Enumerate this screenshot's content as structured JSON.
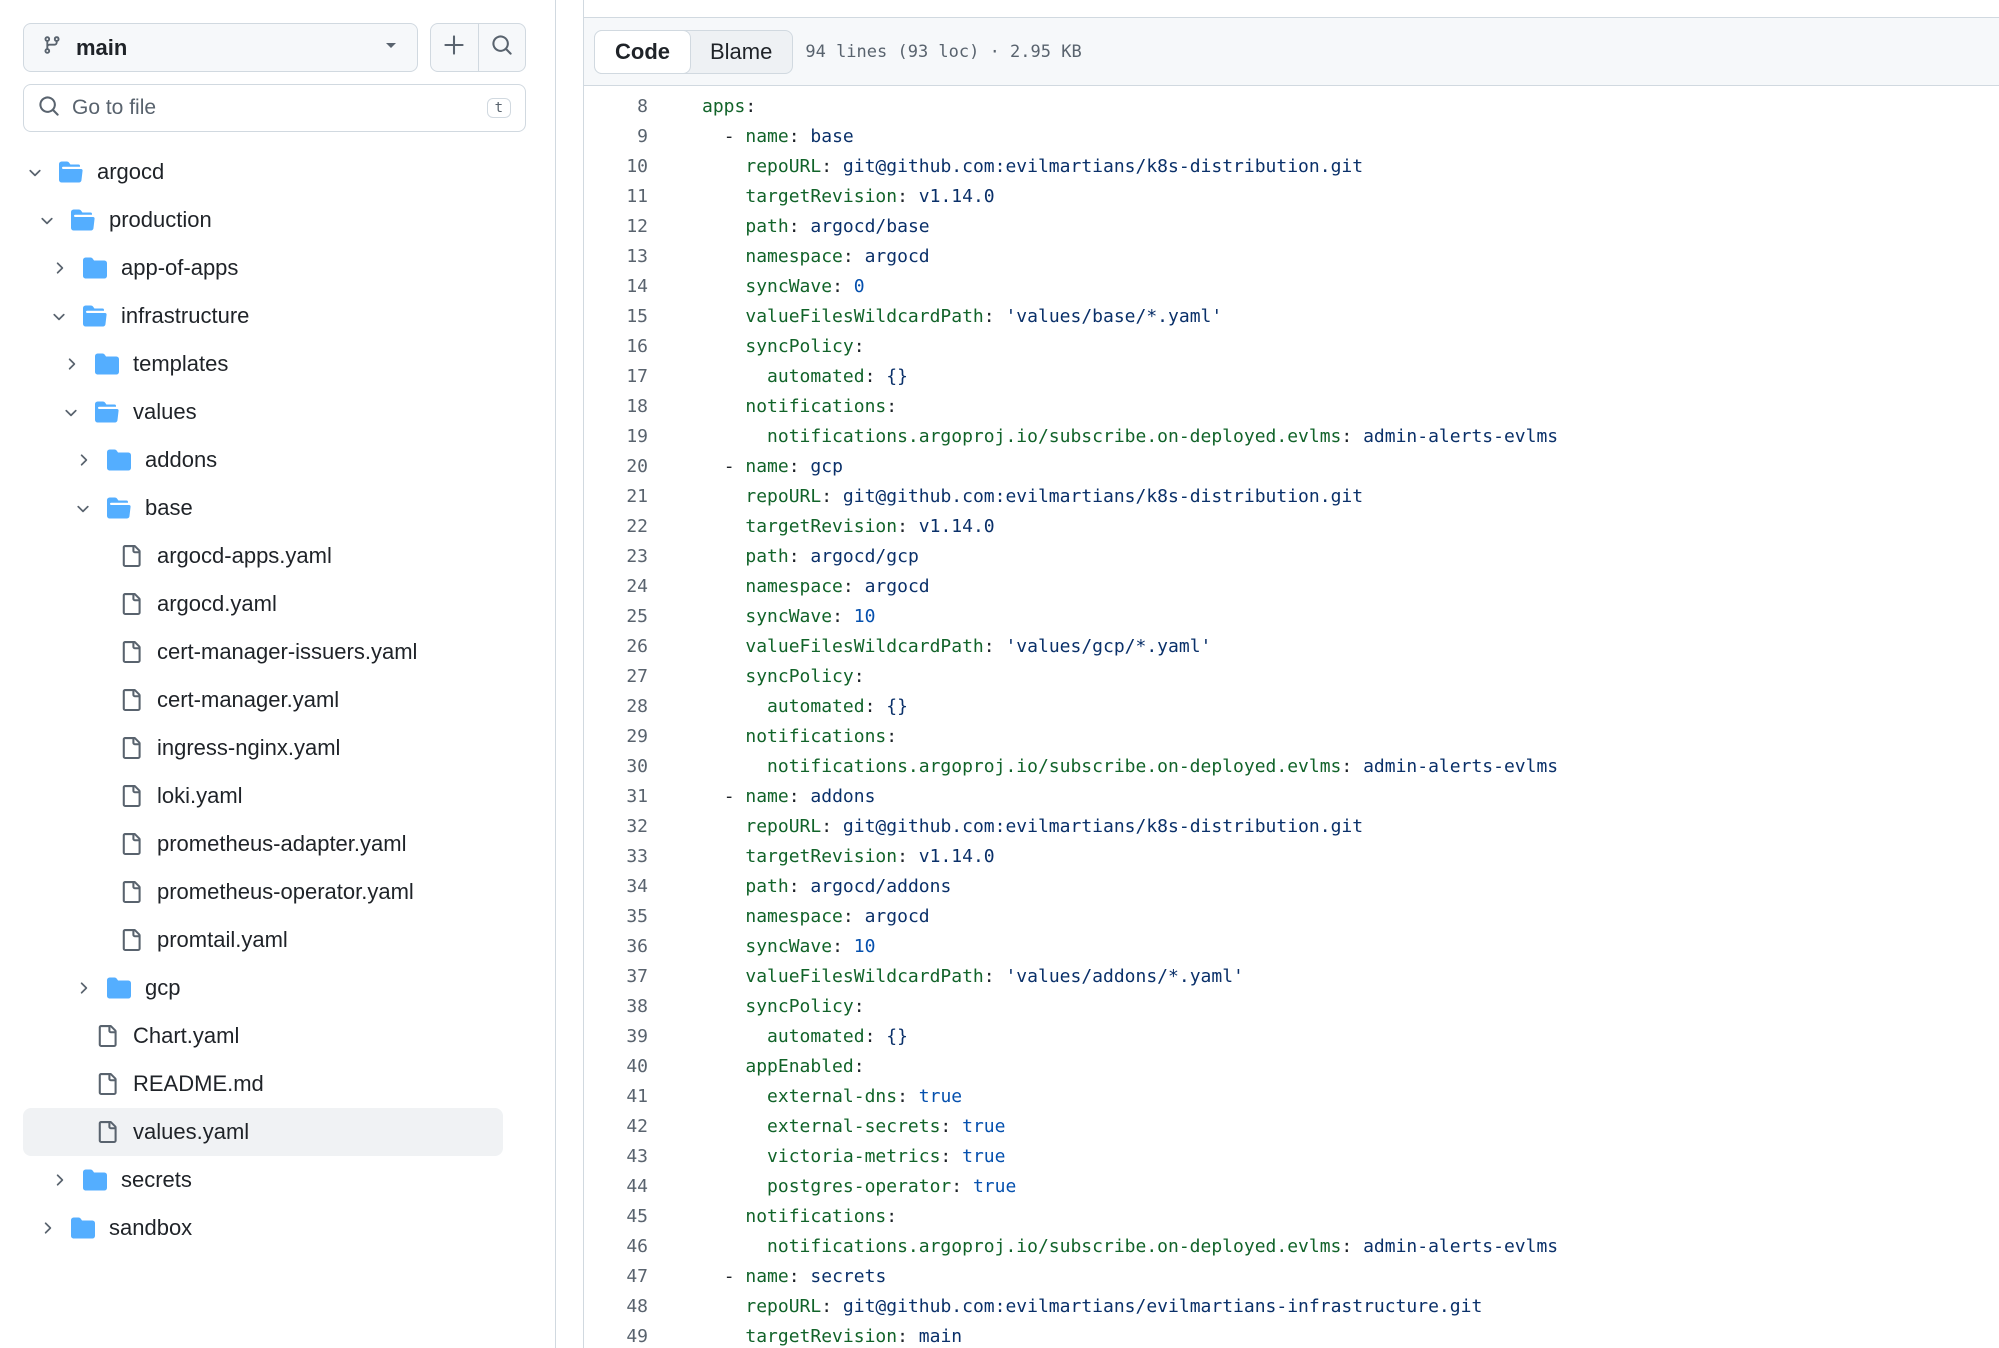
{
  "sidebar": {
    "branch": "main",
    "goto_placeholder": "Go to file",
    "goto_shortcut": "t",
    "tree": [
      {
        "name": "argocd",
        "type": "folder",
        "depth": 0,
        "open": true
      },
      {
        "name": "production",
        "type": "folder",
        "depth": 1,
        "open": true
      },
      {
        "name": "app-of-apps",
        "type": "folder",
        "depth": 2,
        "open": false
      },
      {
        "name": "infrastructure",
        "type": "folder",
        "depth": 2,
        "open": true
      },
      {
        "name": "templates",
        "type": "folder",
        "depth": 3,
        "open": false
      },
      {
        "name": "values",
        "type": "folder",
        "depth": 3,
        "open": true
      },
      {
        "name": "addons",
        "type": "folder",
        "depth": 4,
        "open": false
      },
      {
        "name": "base",
        "type": "folder",
        "depth": 4,
        "open": true
      },
      {
        "name": "argocd-apps.yaml",
        "type": "file",
        "depth": 5
      },
      {
        "name": "argocd.yaml",
        "type": "file",
        "depth": 5
      },
      {
        "name": "cert-manager-issuers.yaml",
        "type": "file",
        "depth": 5
      },
      {
        "name": "cert-manager.yaml",
        "type": "file",
        "depth": 5
      },
      {
        "name": "ingress-nginx.yaml",
        "type": "file",
        "depth": 5
      },
      {
        "name": "loki.yaml",
        "type": "file",
        "depth": 5
      },
      {
        "name": "prometheus-adapter.yaml",
        "type": "file",
        "depth": 5
      },
      {
        "name": "prometheus-operator.yaml",
        "type": "file",
        "depth": 5
      },
      {
        "name": "promtail.yaml",
        "type": "file",
        "depth": 5
      },
      {
        "name": "gcp",
        "type": "folder",
        "depth": 4,
        "open": false
      },
      {
        "name": "Chart.yaml",
        "type": "file",
        "depth": 3
      },
      {
        "name": "README.md",
        "type": "file",
        "depth": 3
      },
      {
        "name": "values.yaml",
        "type": "file",
        "depth": 3,
        "selected": true
      },
      {
        "name": "secrets",
        "type": "folder",
        "depth": 2,
        "open": false
      },
      {
        "name": "sandbox",
        "type": "folder",
        "depth": 1,
        "open": false
      }
    ]
  },
  "viewer": {
    "tabs": [
      "Code",
      "Blame"
    ],
    "active_tab": "Code",
    "file_meta": "94 lines (93 loc) · 2.95 KB"
  },
  "colors": {
    "key": "#116329",
    "string": "#0a3069",
    "number": "#0550ae",
    "folder": "#54aeff",
    "border": "#d1d9e0"
  },
  "code": [
    {
      "n": "8",
      "indent": "",
      "dash": false,
      "key": "apps",
      "val": "",
      "vt": "str"
    },
    {
      "n": "9",
      "indent": "  ",
      "dash": true,
      "key": "name",
      "val": "base",
      "vt": "str"
    },
    {
      "n": "10",
      "indent": "    ",
      "dash": false,
      "key": "repoURL",
      "val": "git@github.com:evilmartians/k8s-distribution.git",
      "vt": "str"
    },
    {
      "n": "11",
      "indent": "    ",
      "dash": false,
      "key": "targetRevision",
      "val": "v1.14.0",
      "vt": "str"
    },
    {
      "n": "12",
      "indent": "    ",
      "dash": false,
      "key": "path",
      "val": "argocd/base",
      "vt": "str"
    },
    {
      "n": "13",
      "indent": "    ",
      "dash": false,
      "key": "namespace",
      "val": "argocd",
      "vt": "str"
    },
    {
      "n": "14",
      "indent": "    ",
      "dash": false,
      "key": "syncWave",
      "val": "0",
      "vt": "num"
    },
    {
      "n": "15",
      "indent": "    ",
      "dash": false,
      "key": "valueFilesWildcardPath",
      "val": "'values/base/*.yaml'",
      "vt": "str"
    },
    {
      "n": "16",
      "indent": "    ",
      "dash": false,
      "key": "syncPolicy",
      "val": "",
      "vt": "str"
    },
    {
      "n": "17",
      "indent": "      ",
      "dash": false,
      "key": "automated",
      "val": "{}",
      "vt": "str"
    },
    {
      "n": "18",
      "indent": "    ",
      "dash": false,
      "key": "notifications",
      "val": "",
      "vt": "str"
    },
    {
      "n": "19",
      "indent": "      ",
      "dash": false,
      "key": "notifications.argoproj.io/subscribe.on-deployed.evlms",
      "val": "admin-alerts-evlms",
      "vt": "str"
    },
    {
      "n": "20",
      "indent": "  ",
      "dash": true,
      "key": "name",
      "val": "gcp",
      "vt": "str"
    },
    {
      "n": "21",
      "indent": "    ",
      "dash": false,
      "key": "repoURL",
      "val": "git@github.com:evilmartians/k8s-distribution.git",
      "vt": "str"
    },
    {
      "n": "22",
      "indent": "    ",
      "dash": false,
      "key": "targetRevision",
      "val": "v1.14.0",
      "vt": "str"
    },
    {
      "n": "23",
      "indent": "    ",
      "dash": false,
      "key": "path",
      "val": "argocd/gcp",
      "vt": "str"
    },
    {
      "n": "24",
      "indent": "    ",
      "dash": false,
      "key": "namespace",
      "val": "argocd",
      "vt": "str"
    },
    {
      "n": "25",
      "indent": "    ",
      "dash": false,
      "key": "syncWave",
      "val": "10",
      "vt": "num"
    },
    {
      "n": "26",
      "indent": "    ",
      "dash": false,
      "key": "valueFilesWildcardPath",
      "val": "'values/gcp/*.yaml'",
      "vt": "str"
    },
    {
      "n": "27",
      "indent": "    ",
      "dash": false,
      "key": "syncPolicy",
      "val": "",
      "vt": "str"
    },
    {
      "n": "28",
      "indent": "      ",
      "dash": false,
      "key": "automated",
      "val": "{}",
      "vt": "str"
    },
    {
      "n": "29",
      "indent": "    ",
      "dash": false,
      "key": "notifications",
      "val": "",
      "vt": "str"
    },
    {
      "n": "30",
      "indent": "      ",
      "dash": false,
      "key": "notifications.argoproj.io/subscribe.on-deployed.evlms",
      "val": "admin-alerts-evlms",
      "vt": "str"
    },
    {
      "n": "31",
      "indent": "  ",
      "dash": true,
      "key": "name",
      "val": "addons",
      "vt": "str"
    },
    {
      "n": "32",
      "indent": "    ",
      "dash": false,
      "key": "repoURL",
      "val": "git@github.com:evilmartians/k8s-distribution.git",
      "vt": "str"
    },
    {
      "n": "33",
      "indent": "    ",
      "dash": false,
      "key": "targetRevision",
      "val": "v1.14.0",
      "vt": "str"
    },
    {
      "n": "34",
      "indent": "    ",
      "dash": false,
      "key": "path",
      "val": "argocd/addons",
      "vt": "str"
    },
    {
      "n": "35",
      "indent": "    ",
      "dash": false,
      "key": "namespace",
      "val": "argocd",
      "vt": "str"
    },
    {
      "n": "36",
      "indent": "    ",
      "dash": false,
      "key": "syncWave",
      "val": "10",
      "vt": "num"
    },
    {
      "n": "37",
      "indent": "    ",
      "dash": false,
      "key": "valueFilesWildcardPath",
      "val": "'values/addons/*.yaml'",
      "vt": "str"
    },
    {
      "n": "38",
      "indent": "    ",
      "dash": false,
      "key": "syncPolicy",
      "val": "",
      "vt": "str"
    },
    {
      "n": "39",
      "indent": "      ",
      "dash": false,
      "key": "automated",
      "val": "{}",
      "vt": "str"
    },
    {
      "n": "40",
      "indent": "    ",
      "dash": false,
      "key": "appEnabled",
      "val": "",
      "vt": "str"
    },
    {
      "n": "41",
      "indent": "      ",
      "dash": false,
      "key": "external-dns",
      "val": "true",
      "vt": "num"
    },
    {
      "n": "42",
      "indent": "      ",
      "dash": false,
      "key": "external-secrets",
      "val": "true",
      "vt": "num"
    },
    {
      "n": "43",
      "indent": "      ",
      "dash": false,
      "key": "victoria-metrics",
      "val": "true",
      "vt": "num"
    },
    {
      "n": "44",
      "indent": "      ",
      "dash": false,
      "key": "postgres-operator",
      "val": "true",
      "vt": "num"
    },
    {
      "n": "45",
      "indent": "    ",
      "dash": false,
      "key": "notifications",
      "val": "",
      "vt": "str"
    },
    {
      "n": "46",
      "indent": "      ",
      "dash": false,
      "key": "notifications.argoproj.io/subscribe.on-deployed.evlms",
      "val": "admin-alerts-evlms",
      "vt": "str"
    },
    {
      "n": "47",
      "indent": "  ",
      "dash": true,
      "key": "name",
      "val": "secrets",
      "vt": "str"
    },
    {
      "n": "48",
      "indent": "    ",
      "dash": false,
      "key": "repoURL",
      "val": "git@github.com:evilmartians/evilmartians-infrastructure.git",
      "vt": "str"
    },
    {
      "n": "49",
      "indent": "    ",
      "dash": false,
      "key": "targetRevision",
      "val": "main",
      "vt": "str"
    }
  ]
}
